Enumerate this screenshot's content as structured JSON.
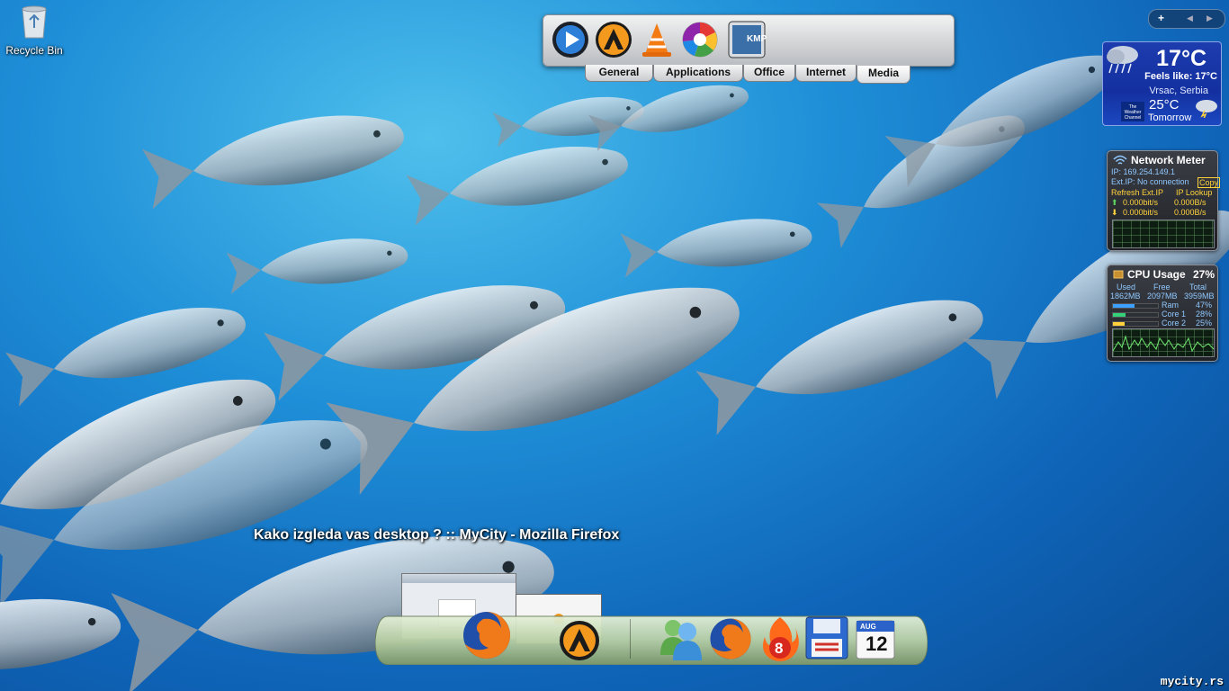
{
  "desktop": {
    "recycle_bin_label": "Recycle Bin",
    "watermark": "mycity.rs"
  },
  "launcher": {
    "icons": [
      "play-button-icon",
      "aimp-icon",
      "vlc-icon",
      "picasa-icon",
      "kmplayer-icon"
    ],
    "kmp_label": "KMP",
    "tabs": [
      "General",
      "Applications",
      "Office",
      "Internet",
      "Media"
    ],
    "active_tab": "Media"
  },
  "gadget_controls": {
    "add": "+",
    "prev": "◀",
    "next": "▶"
  },
  "weather": {
    "temperature": "17°C",
    "feels_like": "Feels like: 17°C",
    "location": "Vrsac, Serbia",
    "tomorrow_temp": "25°C",
    "tomorrow_label": "Tomorrow",
    "provider": "The Weather Channel"
  },
  "network_meter": {
    "title": "Network Meter",
    "ip": "IP: 169.254.149.1",
    "ext_ip": "Ext.IP: No connection",
    "copy": "Copy",
    "refresh": "Refresh Ext.IP",
    "lookup": "IP Lookup",
    "up1": "0.000bit/s",
    "up2": "0.000B/s",
    "down1": "0.000bit/s",
    "down2": "0.000B/s"
  },
  "cpu_usage": {
    "title": "CPU Usage",
    "percent": "27%",
    "used_label": "Used",
    "free_label": "Free",
    "total_label": "Total",
    "used": "1862MB",
    "free": "2097MB",
    "total": "3959MB",
    "rows": [
      {
        "label": "Ram",
        "value": "47%",
        "level": 0.47,
        "color": "#3ba0ff"
      },
      {
        "label": "Core 1",
        "value": "28%",
        "level": 0.28,
        "color": "#33d17a"
      },
      {
        "label": "Core 2",
        "value": "25%",
        "level": 0.25,
        "color": "#ffd23c"
      }
    ]
  },
  "taskbar_caption": "Kako izgleda vas desktop ? :: MyCity - Mozilla Firefox",
  "dock": {
    "icons": [
      "firefox-icon",
      "aimp-icon",
      "messenger-icon",
      "firefox-icon",
      "ie8-icon",
      "floppy-save-icon",
      "calendar-icon"
    ],
    "calendar_month": "AUG",
    "calendar_day": "12",
    "ie_label": "8"
  }
}
